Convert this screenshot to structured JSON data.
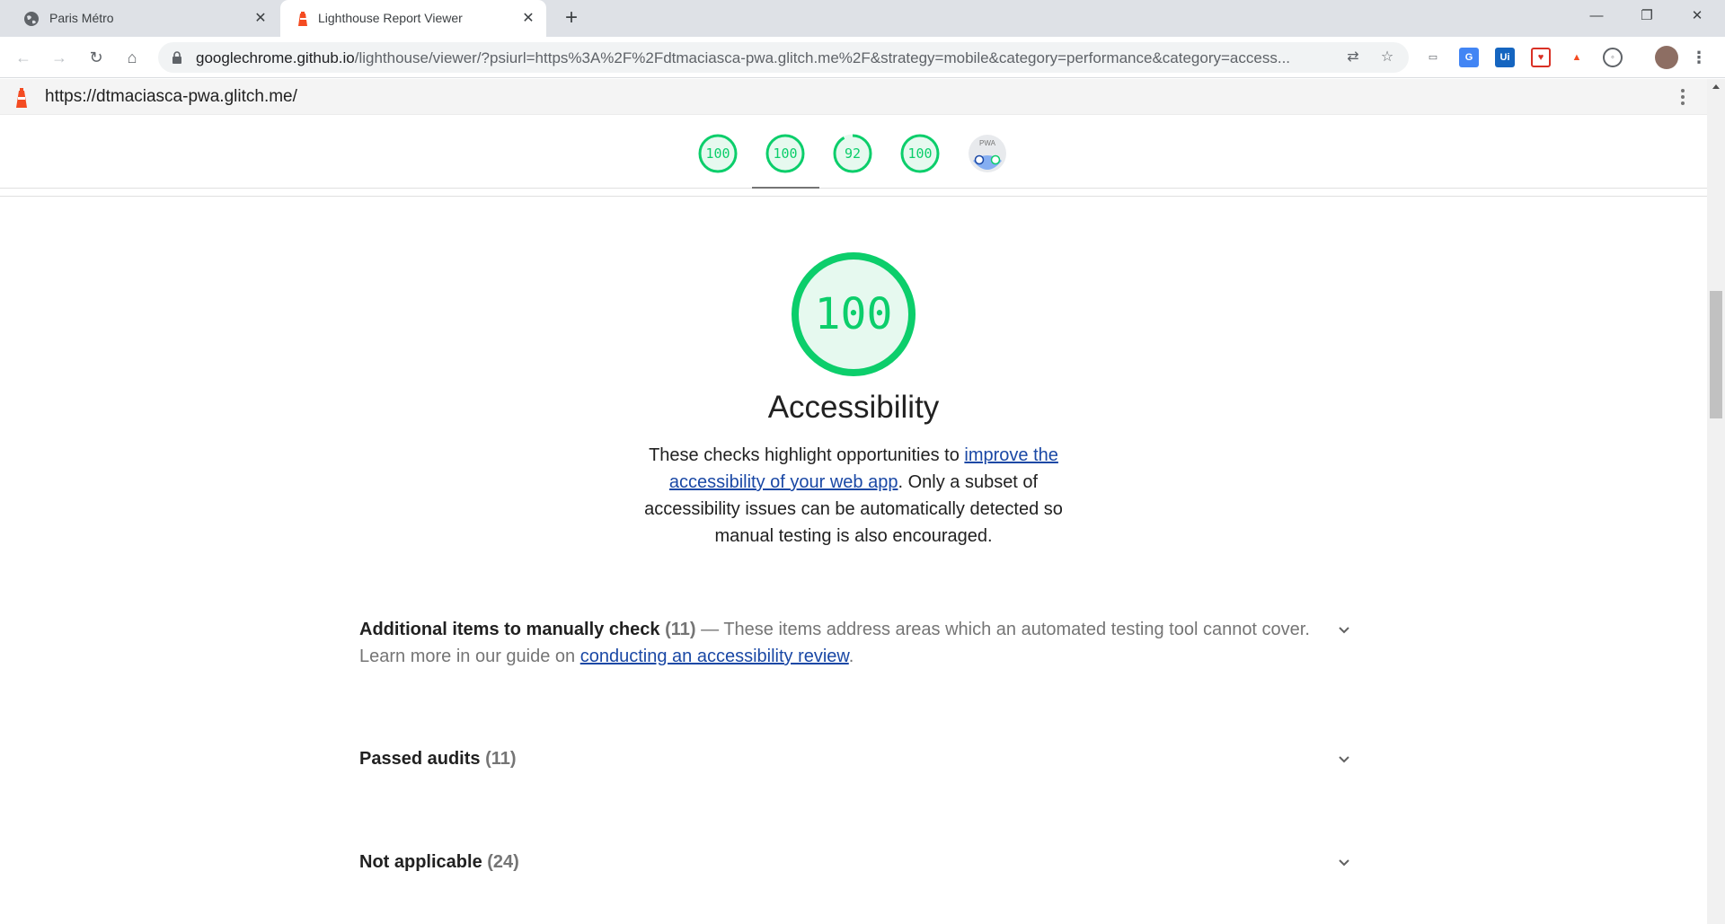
{
  "browser": {
    "tabs": [
      {
        "title": "Paris Métro",
        "favicon": "globe-icon",
        "active": false
      },
      {
        "title": "Lighthouse Report Viewer",
        "favicon": "lighthouse-icon",
        "active": true
      }
    ],
    "new_tab_label": "+",
    "url_host": "googlechrome.github.io",
    "url_path": "/lighthouse/viewer/?psiurl=https%3A%2F%2Fdtmaciasca-pwa.glitch.me%2F&strategy=mobile&category=performance&category=access..."
  },
  "report": {
    "site_url": "https://dtmaciasca-pwa.glitch.me/",
    "gauges": [
      {
        "label": "100",
        "score": 100,
        "name": "performance"
      },
      {
        "label": "100",
        "score": 100,
        "name": "accessibility"
      },
      {
        "label": "92",
        "score": 92,
        "name": "best-practices"
      },
      {
        "label": "100",
        "score": 100,
        "name": "seo"
      },
      {
        "label": "PWA",
        "name": "pwa"
      }
    ],
    "selected_gauge": "accessibility",
    "category": {
      "score_label": "100",
      "score": 100,
      "title": "Accessibility",
      "desc_prefix": "These checks highlight opportunities to ",
      "desc_link": "improve the accessibility of your web app",
      "desc_suffix": ". Only a subset of accessibility issues can be automatically detected so manual testing is also encouraged."
    },
    "groups": [
      {
        "title": "Additional items to manually check",
        "count": "(11)",
        "desc": " — These items address areas which an automated testing tool cannot cover. Learn more in our guide on ",
        "link": "conducting an accessibility review",
        "desc_end": "."
      },
      {
        "title": "Passed audits",
        "count": "(11)"
      },
      {
        "title": "Not applicable",
        "count": "(24)"
      }
    ]
  },
  "colors": {
    "pass": "#0cce6b",
    "pass_bg": "#e6f9ef",
    "average": "#ffa400",
    "link": "#1a48a5",
    "lighthouse_orange": "#f44b21"
  }
}
